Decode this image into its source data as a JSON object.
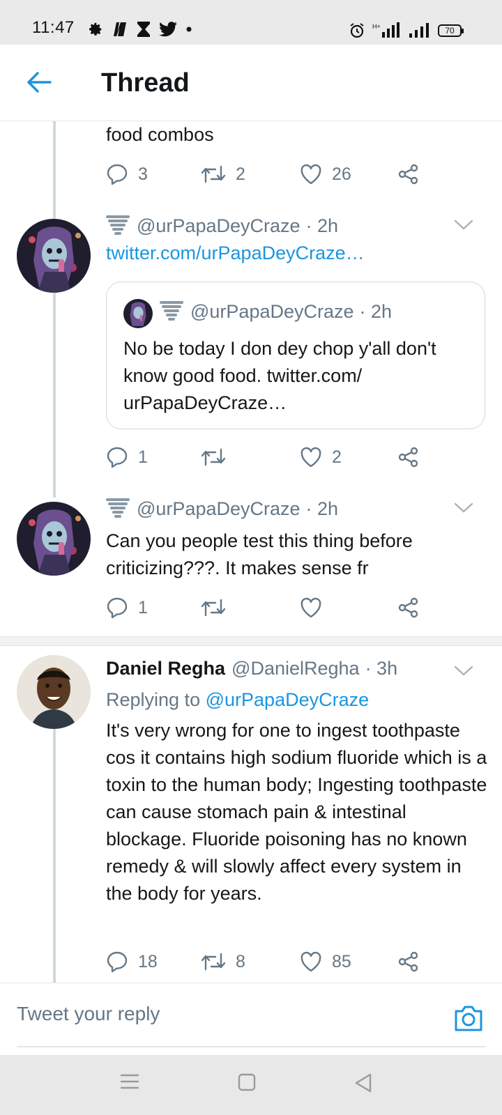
{
  "status_bar": {
    "time": "11:47",
    "left_icons": [
      "gear-icon",
      "netflix-icon",
      "hourglass-icon",
      "twitter-bird-icon",
      "dot-icon"
    ],
    "right_icons": [
      "alarm-icon",
      "signal-hplus-icon",
      "signal-icon"
    ],
    "battery": "70"
  },
  "header": {
    "title": "Thread",
    "back_icon": "arrow-left-icon"
  },
  "colors": {
    "accent": "#1b95e0",
    "muted": "#657786",
    "text": "#14171a",
    "divider": "#e1e8ed"
  },
  "top_tweet_tail": {
    "text": "food combos",
    "replies": "3",
    "retweets": "2",
    "likes": "26"
  },
  "tweet2": {
    "handle": "@urPapaDeyCraze",
    "time": "· 2h",
    "link": "twitter.com/urPapaDeyCraze…",
    "quote": {
      "handle": "@urPapaDeyCraze",
      "time": "· 2h",
      "text": "No be today I don dey chop y'all don't know good food. twitter.com/ urPapaDeyCraze…"
    },
    "replies": "1",
    "retweets": "",
    "likes": "2"
  },
  "tweet3": {
    "handle": "@urPapaDeyCraze",
    "time": "· 2h",
    "text": "Can you people test this thing before criticizing???. It makes sense fr",
    "replies": "1",
    "retweets": "",
    "likes": ""
  },
  "reply_tweet": {
    "name": "Daniel Regha",
    "handle": "@DanielRegha",
    "time": "· 3h",
    "replying_label": "Replying to",
    "replying_to": "@urPapaDeyCraze",
    "text": "It's very wrong for one to ingest toothpaste cos it contains high sodium fluoride which is a toxin to the human body; Ingesting toothpaste can cause stomach pain & intestinal blockage. Fluoride poisoning has no known remedy & will slowly affect every system in the body for years.",
    "replies": "18",
    "retweets": "8",
    "likes": "85"
  },
  "reply_bar": {
    "placeholder": "Tweet your reply",
    "camera_icon": "camera-icon"
  },
  "nav_bar": {
    "icons": [
      "menu-icon",
      "home-square-icon",
      "back-triangle-icon"
    ]
  }
}
